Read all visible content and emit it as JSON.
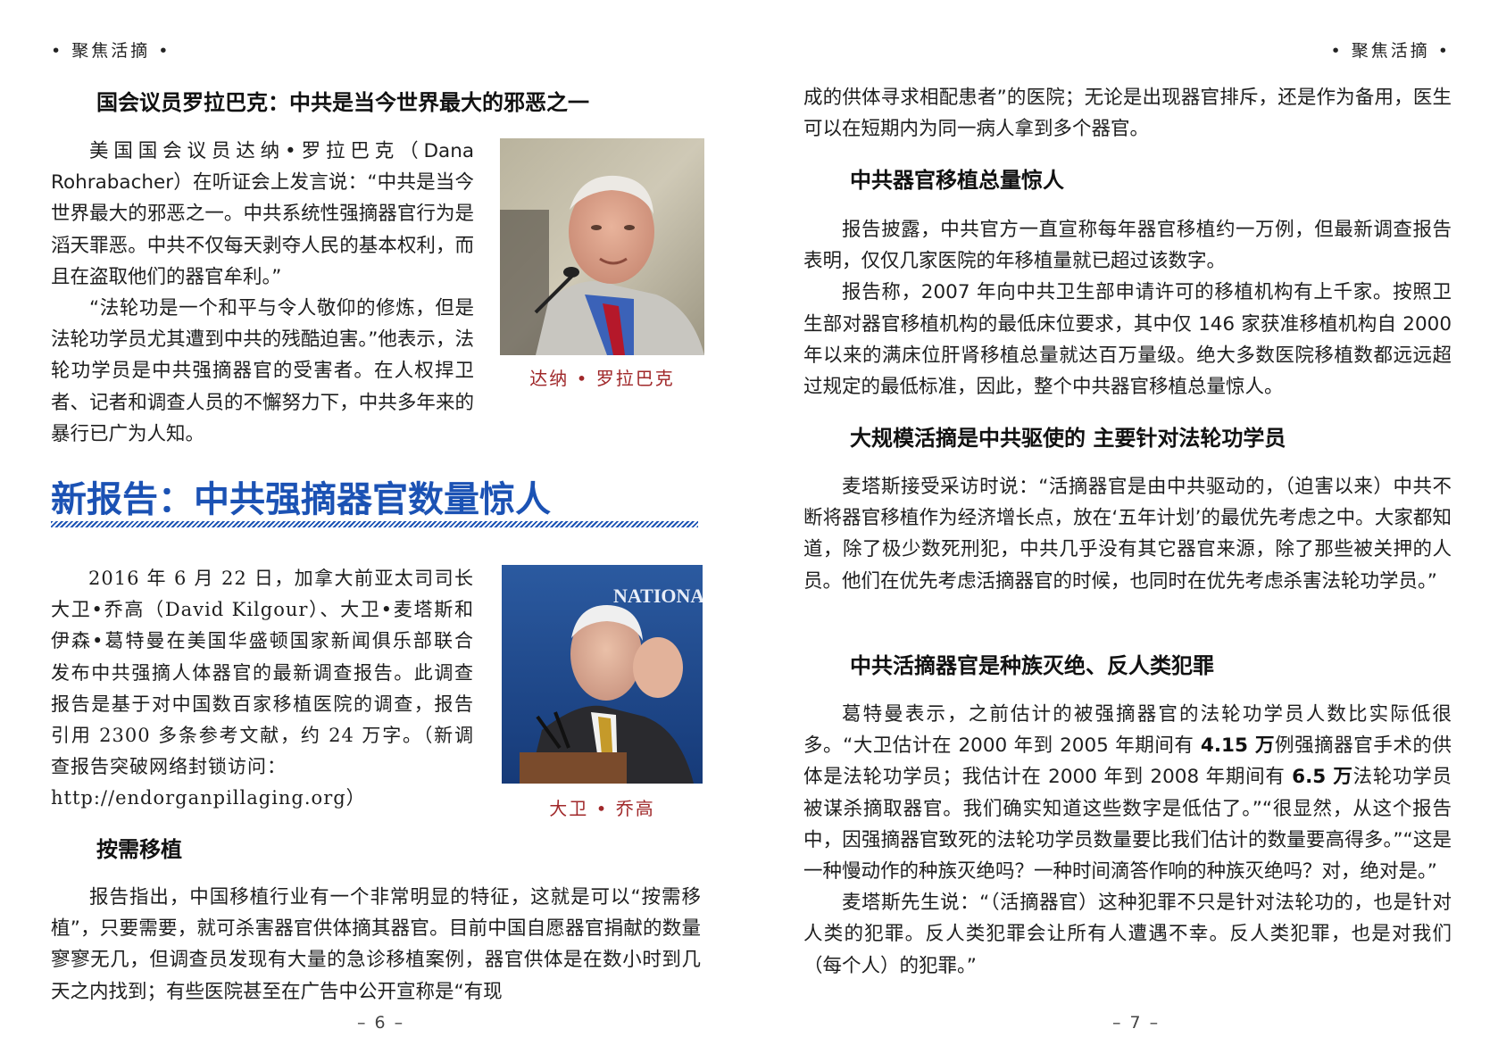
{
  "left": {
    "header": "• 聚焦活摘 •",
    "section1_title": "国会议员罗拉巴克：中共是当今世界最大的邪恶之一",
    "section1_paragraphs": [
      "美国国会议员达纳•罗拉巴克（Dana Rohrabacher）在听证会上发言说：“中共是当今世界最大的邪恶之一。中共系统性强摘器官行为是滔天罪恶。中共不仅每天剥夺人民的基本权利，而且在盗取他们的器官牟利。”",
      "“法轮功是一个和平与令人敬仰的修炼，但是法轮功学员尤其遭到中共的残酷迫害。”他表示，法轮功学员是中共强摘器官的受害者。在人权捍卫者、记者和调查人员的不懈努力下，中共多年来的暴行已广为人知。"
    ],
    "photo1_caption": "达纳 • 罗拉巴克",
    "main_title": "新报告：中共强摘器官数量惊人",
    "section2_paragraph": "2016 年 6 月 22 日，加拿大前亚太司司长大卫•乔高（David Kilgour）、大卫•麦塔斯和伊森•葛特曼在美国华盛顿国家新闻俱乐部联合发布中共强摘人体器官的最新调查报告。此调查报告是基于对中国数百家移植医院的调查，报告引用 2300 多条参考文献，约 24 万字。（新调查报告突破网络封锁访问：",
    "section2_url": "http://endorganpillaging.org）",
    "photo2_caption": "大卫 • 乔高",
    "photo2_sign": "NATIONAL PRESS",
    "subhead1": "按需移植",
    "subhead1_paragraph": "报告指出，中国移植行业有一个非常明显的特征，这就是可以“按需移植”，只要需要，就可杀害器官供体摘其器官。目前中国自愿器官捐献的数量寥寥无几，但调查员发现有大量的急诊移植案例，器官供体是在数小时到几天之内找到；有些医院甚至在广告中公开宣称是“有现",
    "page_number": "– 6 –"
  },
  "right": {
    "header": "• 聚焦活摘 •",
    "continuation": "成的供体寻求相配患者”的医院；无论是出现器官排斥，还是作为备用，医生可以在短期内为同一病人拿到多个器官。",
    "subhead2": "中共器官移植总量惊人",
    "subhead2_paragraphs": [
      "报告披露，中共官方一直宣称每年器官移植约一万例，但最新调查报告表明，仅仅几家医院的年移植量就已超过该数字。",
      "报告称，2007 年向中共卫生部申请许可的移植机构有上千家。按照卫生部对器官移植机构的最低床位要求，其中仅 146 家获准移植机构自 2000 年以来的满床位肝肾移植总量就达百万量级。绝大多数医院移植数都远远超过规定的最低标准，因此，整个中共器官移植总量惊人。"
    ],
    "subhead3": "大规模活摘是中共驱使的  主要针对法轮功学员",
    "subhead3_paragraph": "麦塔斯接受采访时说：“活摘器官是由中共驱动的，（迫害以来）中共不断将器官移植作为经济增长点，放在‘五年计划’的最优先考虑之中。大家都知道，除了极少数死刑犯，中共几乎没有其它器官来源，除了那些被关押的人员。他们在优先考虑活摘器官的时候，也同时在优先考虑杀害法轮功学员。”",
    "subhead4": "中共活摘器官是种族灭绝、反人类犯罪",
    "subhead4_p1_a": "葛特曼表示，之前估计的被强摘器官的法轮功学员人数比实际低很多。“大卫估计在 2000 年到 2005 年期间有 ",
    "subhead4_p1_num1": "4.15 万",
    "subhead4_p1_b": "例强摘器官手术的供体是法轮功学员；我估计在 2000 年到 2008 年期间有 ",
    "subhead4_p1_num2": "6.5 万",
    "subhead4_p1_c": "法轮功学员被谋杀摘取器官。我们确实知道这些数字是低估了。”“很显然，从这个报告中，因强摘器官致死的法轮功学员数量要比我们估计的数量要高得多。”“这是一种慢动作的种族灭绝吗？一种时间滴答作响的种族灭绝吗？对，绝对是。”",
    "subhead4_p2": "麦塔斯先生说：“（活摘器官）这种犯罪不只是针对法轮功的，也是针对人类的犯罪。反人类犯罪会让所有人遭遇不幸。反人类犯罪，也是对我们（每个人）的犯罪。”",
    "page_number": "– 7 –"
  },
  "colors": {
    "title_blue": "#1b52b4",
    "caption_red": "#a0282a"
  },
  "icons": [
    "photo-rohrabacher",
    "photo-kilgour"
  ]
}
